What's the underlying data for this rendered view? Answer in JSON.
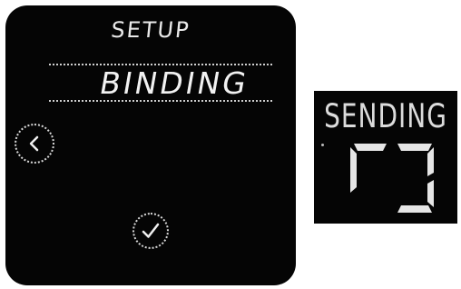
{
  "screen": {
    "title": "SETUP",
    "selected_option": "BINDING",
    "back_icon": "chevron-left-icon",
    "confirm_icon": "check-icon"
  },
  "status_panel": {
    "text": "SENDING",
    "progress_icon": "segment-progress-icon"
  },
  "colors": {
    "background": "#050505",
    "text": "#e9e9e9"
  }
}
